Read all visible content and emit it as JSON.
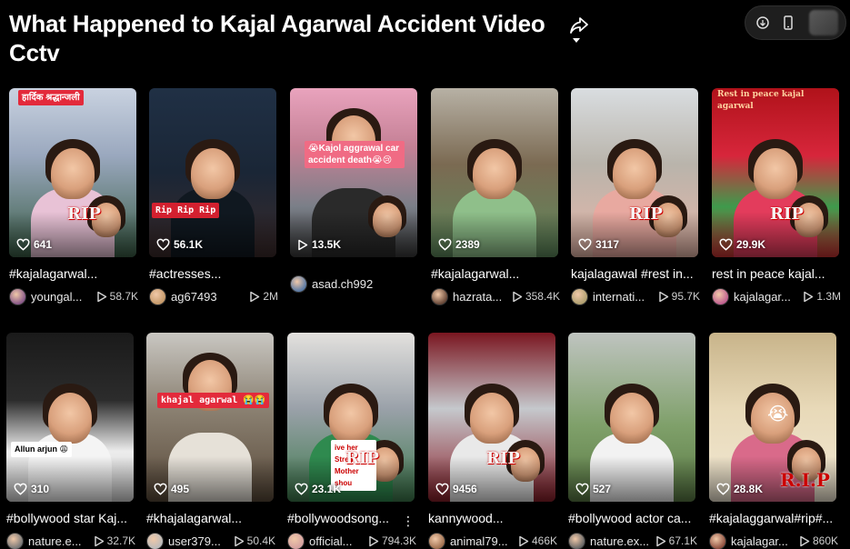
{
  "page": {
    "title": "What Happened to Kajal Agarwal Accident Video Cctv"
  },
  "icons": {
    "share": "share-arrow-icon",
    "menu_caret": "caret-down-icon",
    "pill": [
      "activity-icon",
      "mobile-icon"
    ],
    "views": "heart-outline-icon",
    "plays": "play-outline-icon"
  },
  "colors": {
    "background": "#000000",
    "text": "#ffffff",
    "muted": "#cfcfcf",
    "accent": "#fe2c55"
  },
  "videos": [
    {
      "views": "641",
      "views_icon": "heart",
      "caption": "#kajalagarwal...",
      "username": "youngal...",
      "plays": "58.7K",
      "overlay": "हार्दिक श्रद्धान्जली",
      "rip": "RIP"
    },
    {
      "views": "56.1K",
      "views_icon": "heart",
      "caption": "#actresses...",
      "username": "ag67493",
      "plays": "2M",
      "overlay": "Rip Rip Rip",
      "rip": ""
    },
    {
      "views": "13.5K",
      "views_icon": "play",
      "caption": "",
      "username": "asad.ch992",
      "plays": "",
      "overlay": "😭Kajol aggrawal car accident death😭😢",
      "rip": ""
    },
    {
      "views": "2389",
      "views_icon": "heart",
      "caption": "#kajalagarwal...",
      "username": "hazrata...",
      "plays": "358.4K",
      "overlay": "",
      "rip": ""
    },
    {
      "views": "3117",
      "views_icon": "heart",
      "caption": "kajalagawal #rest in...",
      "username": "internati...",
      "plays": "95.7K",
      "overlay": "",
      "rip": "RIP"
    },
    {
      "views": "29.9K",
      "views_icon": "heart",
      "caption": "rest in peace kajal...",
      "username": "kajalagar...",
      "plays": "1.3M",
      "overlay": "Rest in peace kajal agarwal",
      "rip": "RIP"
    },
    {
      "views": "310",
      "views_icon": "heart",
      "caption": "#bollywood star Kaj...",
      "username": "nature.e...",
      "plays": "32.7K",
      "overlay": "Allun arjun 😩",
      "rip": ""
    },
    {
      "views": "495",
      "views_icon": "heart",
      "caption": "#khajalagarwal...",
      "username": "user379...",
      "plays": "50.4K",
      "overlay": "khajal agarwal 😭😭",
      "rip": ""
    },
    {
      "views": "23.1K",
      "views_icon": "heart",
      "caption": "#bollywoodsong...",
      "username": "official...",
      "plays": "794.3K",
      "overlay": "ive her Stren Mother shou",
      "rip": "RIP"
    },
    {
      "views": "9456",
      "views_icon": "heart",
      "caption": "kannywood...",
      "username": "animal79...",
      "plays": "466K",
      "overlay": "",
      "rip": "RIP"
    },
    {
      "views": "527",
      "views_icon": "heart",
      "caption": "#bollywood actor ca...",
      "username": "nature.ex...",
      "plays": "67.1K",
      "overlay": "",
      "rip": ""
    },
    {
      "views": "28.8K",
      "views_icon": "heart",
      "caption": "#kajalaggarwal#rip#...",
      "username": "kajalagar...",
      "plays": "860K",
      "overlay": "😭",
      "rip": "R.I.P"
    }
  ]
}
